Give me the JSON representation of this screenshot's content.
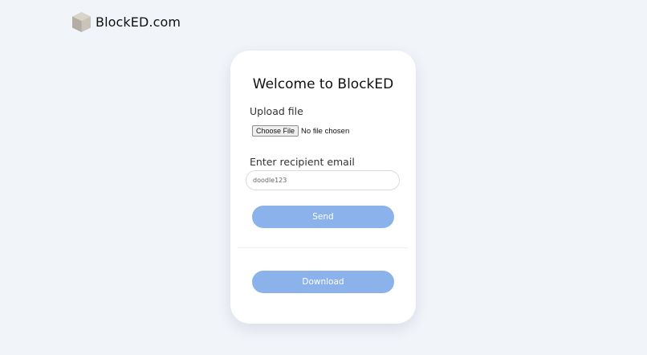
{
  "header": {
    "brand_name": "BlockED.com",
    "logo_icon": "cube-icon"
  },
  "card": {
    "title": "Welcome to BlockED",
    "upload": {
      "label": "Upload file",
      "button_label": "Choose File",
      "status_text": "No file chosen"
    },
    "email": {
      "label": "Enter recipient email",
      "value": "doodle123"
    },
    "send_label": "Send",
    "download_label": "Download"
  },
  "colors": {
    "page_background": "#f1f4f9",
    "button_accent": "#8bb2ea",
    "card_background": "#ffffff"
  }
}
